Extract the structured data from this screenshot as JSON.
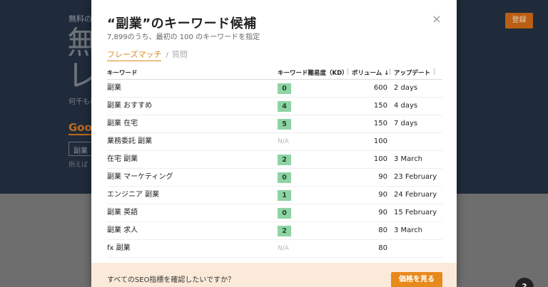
{
  "background": {
    "line1": "無料の",
    "big_text": "無",
    "big_text2": "レ",
    "sub_text": "何千もの",
    "google_link": "Goog",
    "input_value": "副業",
    "example_text": "例えば",
    "register_button": "登録",
    "help_button": "?"
  },
  "modal": {
    "title": "“副業”のキーワード候補",
    "subtitle": "7,899のうち、最初の 100 のキーワードを指定",
    "close_icon": "×",
    "tabs": {
      "active": "フレーズマッチ",
      "separator": "/",
      "inactive": "質問"
    },
    "table": {
      "headers": {
        "keyword": "キーワード",
        "kd": "キーワード難易度（KD）",
        "volume": "ボリューム ↓",
        "updated": "アップデート"
      },
      "rows": [
        {
          "keyword": "副業",
          "kd": "0",
          "volume": "600",
          "updated": "2 days"
        },
        {
          "keyword": "副業 おすすめ",
          "kd": "4",
          "volume": "150",
          "updated": "4 days"
        },
        {
          "keyword": "副業 在宅",
          "kd": "5",
          "volume": "150",
          "updated": "7 days"
        },
        {
          "keyword": "業務委託 副業",
          "kd": "N/A",
          "volume": "100",
          "updated": ""
        },
        {
          "keyword": "在宅 副業",
          "kd": "2",
          "volume": "100",
          "updated": "3 March"
        },
        {
          "keyword": "副業 マーケティング",
          "kd": "0",
          "volume": "90",
          "updated": "23 February"
        },
        {
          "keyword": "エンジニア 副業",
          "kd": "1",
          "volume": "90",
          "updated": "24 February"
        },
        {
          "keyword": "副業 英語",
          "kd": "0",
          "volume": "90",
          "updated": "15 February"
        },
        {
          "keyword": "副業 求人",
          "kd": "2",
          "volume": "80",
          "updated": "3 March"
        },
        {
          "keyword": "fx 副業",
          "kd": "N/A",
          "volume": "80",
          "updated": ""
        }
      ]
    },
    "cta": {
      "text": "すべてのSEO指標を確認したいですか？",
      "button": "価格を見る"
    }
  },
  "colors": {
    "accent": "#e0891f",
    "kd_badge": "#8fd3a5",
    "background_dark": "#1f2b3a"
  }
}
